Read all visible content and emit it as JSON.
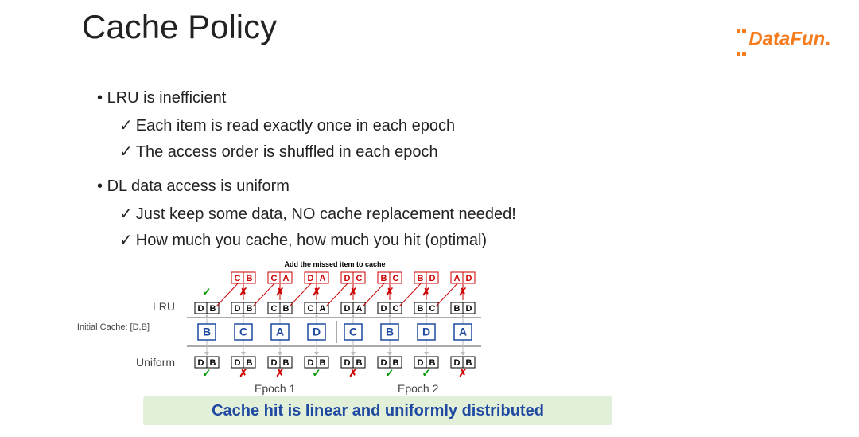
{
  "title": "Cache Policy",
  "brand": {
    "name": "DataFun",
    "suffix": "."
  },
  "bullets": {
    "b1": "LRU is inefficient",
    "b1s1": "Each item is read exactly once in each epoch",
    "b1s2": "The access order is shuffled in each epoch",
    "b2": "DL data access is uniform",
    "b2s1": "Just keep some data, NO cache replacement needed!",
    "b2s2": "How much you cache, how much you hit (optimal)"
  },
  "diagram": {
    "initial_cache_label": "Initial Cache: [D,B]",
    "row_labels": {
      "lru": "LRU",
      "uniform": "Uniform"
    },
    "epoch_labels": {
      "e1": "Epoch 1",
      "e2": "Epoch 2"
    },
    "add_label": "Add the missed  item to cache",
    "access_seq": [
      "B",
      "C",
      "A",
      "D",
      "C",
      "B",
      "D",
      "A"
    ],
    "lru_added": [
      [
        "C",
        "B"
      ],
      [
        "C",
        "A"
      ],
      [
        "D",
        "A"
      ],
      [
        "D",
        "C"
      ],
      [
        "B",
        "C"
      ],
      [
        "B",
        "D"
      ],
      [
        "A",
        "D"
      ]
    ],
    "lru_cache": [
      [
        "D",
        "B"
      ],
      [
        "D",
        "B"
      ],
      [
        "C",
        "B"
      ],
      [
        "C",
        "A"
      ],
      [
        "D",
        "A"
      ],
      [
        "D",
        "C"
      ],
      [
        "B",
        "C"
      ],
      [
        "B",
        "D"
      ]
    ],
    "lru_marks": [
      "hit",
      "miss",
      "miss",
      "miss",
      "miss",
      "miss",
      "miss",
      "miss"
    ],
    "uniform_cache": [
      [
        "D",
        "B"
      ],
      [
        "D",
        "B"
      ],
      [
        "D",
        "B"
      ],
      [
        "D",
        "B"
      ],
      [
        "D",
        "B"
      ],
      [
        "D",
        "B"
      ],
      [
        "D",
        "B"
      ],
      [
        "D",
        "B"
      ]
    ],
    "uniform_marks": [
      "hit",
      "miss",
      "miss",
      "hit",
      "miss",
      "hit",
      "hit",
      "miss"
    ]
  },
  "footer": "Cache hit is linear and uniformly distributed"
}
